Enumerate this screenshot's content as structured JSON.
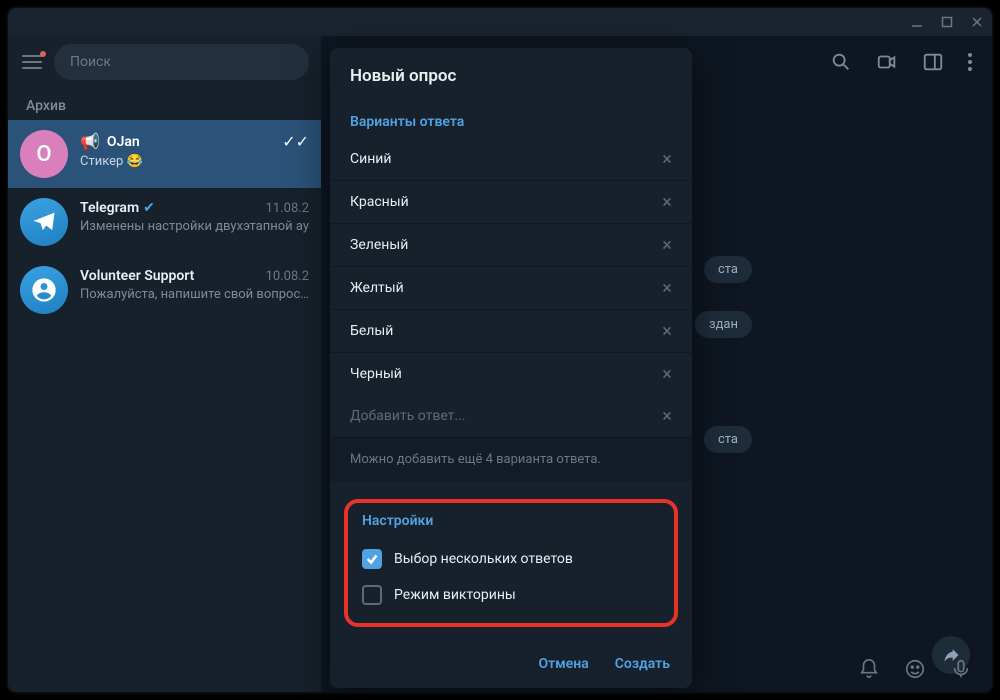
{
  "titlebar": {
    "icons": [
      "minimize",
      "maximize",
      "close"
    ]
  },
  "sidebar": {
    "search_placeholder": "Поиск",
    "archive_label": "Архив",
    "chats": [
      {
        "avatar_letter": "O",
        "name": "OJan",
        "megaphone": true,
        "message": "Стикер 😂",
        "date": "",
        "checks": true,
        "active": true
      },
      {
        "avatar_letter": "",
        "name": "Telegram",
        "verified": true,
        "message": "Изменены настройки двухэтапной ау",
        "date": "11.08.2"
      },
      {
        "avatar_letter": "",
        "name": "Volunteer Support",
        "message": "Пожалуйста, напишите свой вопрос н",
        "date": "10.08.2"
      }
    ]
  },
  "main": {
    "badges": [
      "ста",
      "здан",
      "ста"
    ]
  },
  "modal": {
    "title": "Новый опрос",
    "options_header": "Варианты ответа",
    "options": [
      "Синий",
      "Красный",
      "Зеленый",
      "Желтый",
      "Белый",
      "Черный"
    ],
    "add_option_placeholder": "Добавить ответ...",
    "options_hint": "Можно добавить ещё 4 варианта ответа.",
    "settings_header": "Настройки",
    "settings": [
      {
        "label": "Выбор нескольких ответов",
        "checked": true
      },
      {
        "label": "Режим викторины",
        "checked": false
      }
    ],
    "cancel_label": "Отмена",
    "create_label": "Создать"
  }
}
